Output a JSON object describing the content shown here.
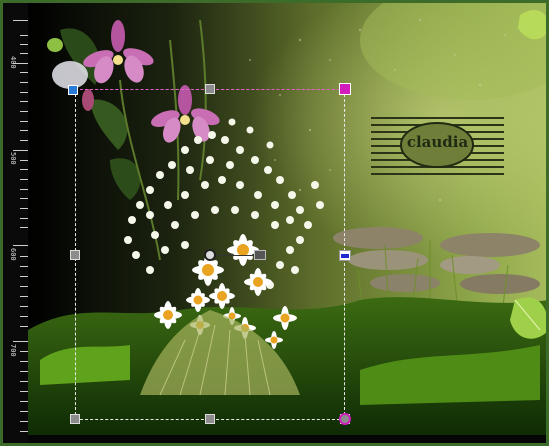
{
  "app": {
    "name": "image-editor-pick-tool"
  },
  "ruler": {
    "side": "left",
    "labels": [
      {
        "text": "400",
        "value": 400
      },
      {
        "text": "500",
        "value": 500
      },
      {
        "text": "600",
        "value": 600
      },
      {
        "text": "700",
        "value": 700
      }
    ]
  },
  "canvas": {
    "watermark_text": "claudia",
    "colors": {
      "frame": "#3d6b2a",
      "selection": "#e9e9e9",
      "rotate_handle": "#d21cbb",
      "perspective_marker": "#1d2bd0",
      "ruler_bg": "#0a0a0a"
    }
  },
  "tool": {
    "name": "pick",
    "handles": [
      "top-left",
      "top-middle",
      "top-right-rotate",
      "middle-left",
      "middle-right-perspective",
      "pivot",
      "skew",
      "bottom-left",
      "bottom-middle",
      "bottom-right"
    ]
  }
}
